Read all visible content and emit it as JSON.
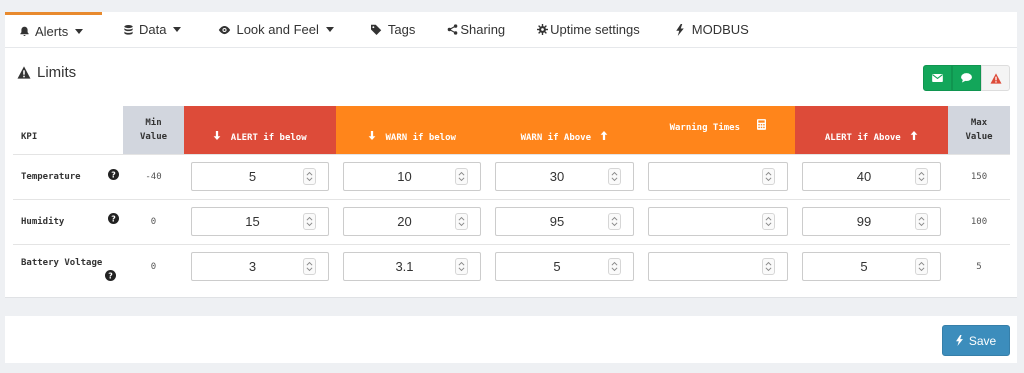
{
  "tabs": [
    {
      "label": "Alerts",
      "icon": "bell-icon",
      "dropdown": true,
      "active": true
    },
    {
      "label": "Data",
      "icon": "database-icon",
      "dropdown": true
    },
    {
      "label": "Look and Feel",
      "icon": "eye-icon",
      "dropdown": true
    },
    {
      "label": "Tags",
      "icon": "tags-icon"
    },
    {
      "label": "Sharing",
      "icon": "share-icon"
    },
    {
      "label": "Uptime settings",
      "icon": "cog-icon"
    },
    {
      "label": "MODBUS",
      "icon": "bolt-icon"
    }
  ],
  "panel": {
    "title": "Limits",
    "title_icon": "warning-icon",
    "notify_buttons": [
      "envelope-icon",
      "comment-icon",
      "warning-icon"
    ]
  },
  "table": {
    "headers": {
      "kpi": "KPI",
      "min": "Min Value",
      "alert_below": "ALERT if below",
      "warn_below": "WARN if below",
      "warn_above": "WARN if Above",
      "warning_times": "Warning Times",
      "alert_above": "ALERT if Above",
      "max": "Max Value"
    },
    "rows": [
      {
        "kpi": "Temperature",
        "min": "-40",
        "alert_below": "5",
        "warn_below": "10",
        "warn_above": "30",
        "warning_times": "",
        "alert_above": "40",
        "max": "150"
      },
      {
        "kpi": "Humidity",
        "min": "0",
        "alert_below": "15",
        "warn_below": "20",
        "warn_above": "95",
        "warning_times": "",
        "alert_above": "99",
        "max": "100"
      },
      {
        "kpi": "Battery Voltage",
        "min": "0",
        "alert_below": "3",
        "warn_below": "3.1",
        "warn_above": "5",
        "warning_times": "",
        "alert_above": "5",
        "max": "5"
      }
    ]
  },
  "footer": {
    "save_label": "Save"
  },
  "colors": {
    "alert": "#dd4b39",
    "warn": "#ff851b",
    "gray": "#d2d6de",
    "primary": "#3c8dbc",
    "success": "#13a65a",
    "tab_active": "#e88a2e"
  }
}
